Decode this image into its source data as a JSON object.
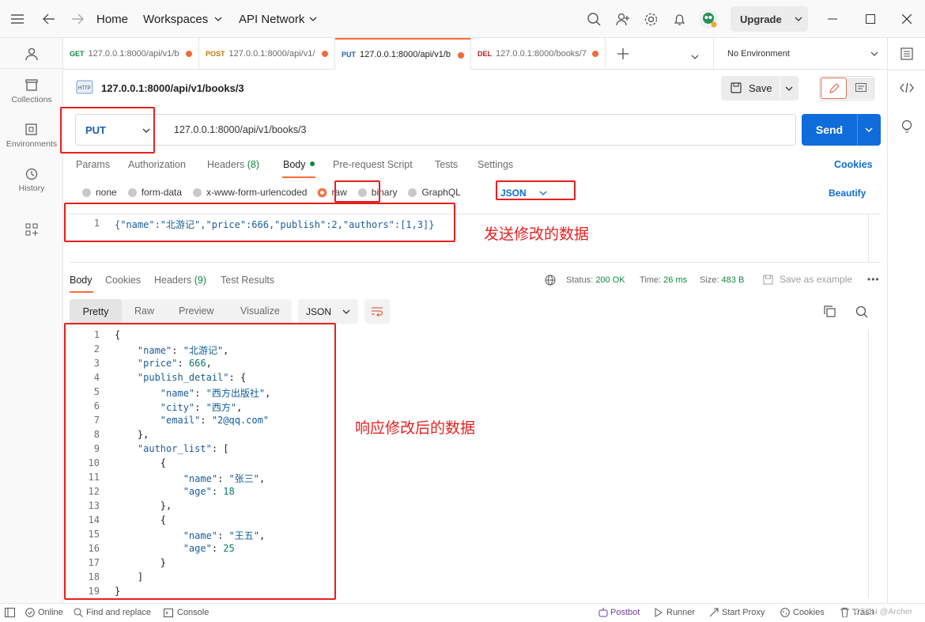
{
  "topbar": {
    "home": "Home",
    "workspaces": "Workspaces",
    "api_network": "API Network",
    "upgrade": "Upgrade"
  },
  "sidebar": {
    "items": [
      {
        "label": "Collections"
      },
      {
        "label": "Environments"
      },
      {
        "label": "History"
      }
    ]
  },
  "tabs": [
    {
      "method": "GET",
      "url": "127.0.0.1:8000/api/v1/b",
      "color": "#0f8a3c"
    },
    {
      "method": "POST",
      "url": "127.0.0.1:8000/api/v1/",
      "color": "#c87800"
    },
    {
      "method": "PUT",
      "url": "127.0.0.1:8000/api/v1/b",
      "color": "#1b5fae"
    },
    {
      "method": "DEL",
      "url": "127.0.0.1:8000/books/7",
      "color": "#b5221b"
    }
  ],
  "environment": "No Environment",
  "request": {
    "title": "127.0.0.1:8000/api/v1/books/3",
    "method": "PUT",
    "url": "127.0.0.1:8000/api/v1/books/3",
    "save": "Save",
    "send": "Send"
  },
  "req_tabs": {
    "params": "Params",
    "authorization": "Authorization",
    "headers": "Headers",
    "headers_count": "(8)",
    "body": "Body",
    "prerequest": "Pre-request Script",
    "tests": "Tests",
    "settings": "Settings",
    "cookies": "Cookies"
  },
  "body_types": {
    "none": "none",
    "form_data": "form-data",
    "urlencoded": "x-www-form-urlencoded",
    "raw": "raw",
    "binary": "binary",
    "graphql": "GraphQL",
    "format": "JSON",
    "beautify": "Beautify"
  },
  "request_body": {
    "line": "1",
    "text": "{\"name\":\"北游记\",\"price\":666,\"publish\":2,\"authors\":[1,3]}"
  },
  "annotations": {
    "request": "发送修改的数据",
    "response": "响应修改后的数据"
  },
  "response": {
    "tabs": {
      "body": "Body",
      "cookies": "Cookies",
      "headers": "Headers",
      "headers_count": "(9)",
      "tests": "Test Results"
    },
    "status_label": "Status:",
    "status": "200 OK",
    "time_label": "Time:",
    "time": "26 ms",
    "size_label": "Size:",
    "size": "483 B",
    "save_example": "Save as example",
    "views": {
      "pretty": "Pretty",
      "raw": "Raw",
      "preview": "Preview",
      "visualize": "Visualize",
      "format": "JSON"
    }
  },
  "response_lines": [
    "{",
    "    \"name\": \"北游记\",",
    "    \"price\": 666,",
    "    \"publish_detail\": {",
    "        \"name\": \"西方出版社\",",
    "        \"city\": \"西方\",",
    "        \"email\": \"2@qq.com\"",
    "    },",
    "    \"author_list\": [",
    "        {",
    "            \"name\": \"张三\",",
    "            \"age\": 18",
    "        },",
    "        {",
    "            \"name\": \"王五\",",
    "            \"age\": 25",
    "        }",
    "    ]",
    "}"
  ],
  "statusbar": {
    "online": "Online",
    "find": "Find and replace",
    "console": "Console",
    "postbot": "Postbot",
    "runner": "Runner",
    "proxy": "Start Proxy",
    "cookies": "Cookies",
    "trash": "Trash",
    "watermark": "CSDN @Archer"
  }
}
